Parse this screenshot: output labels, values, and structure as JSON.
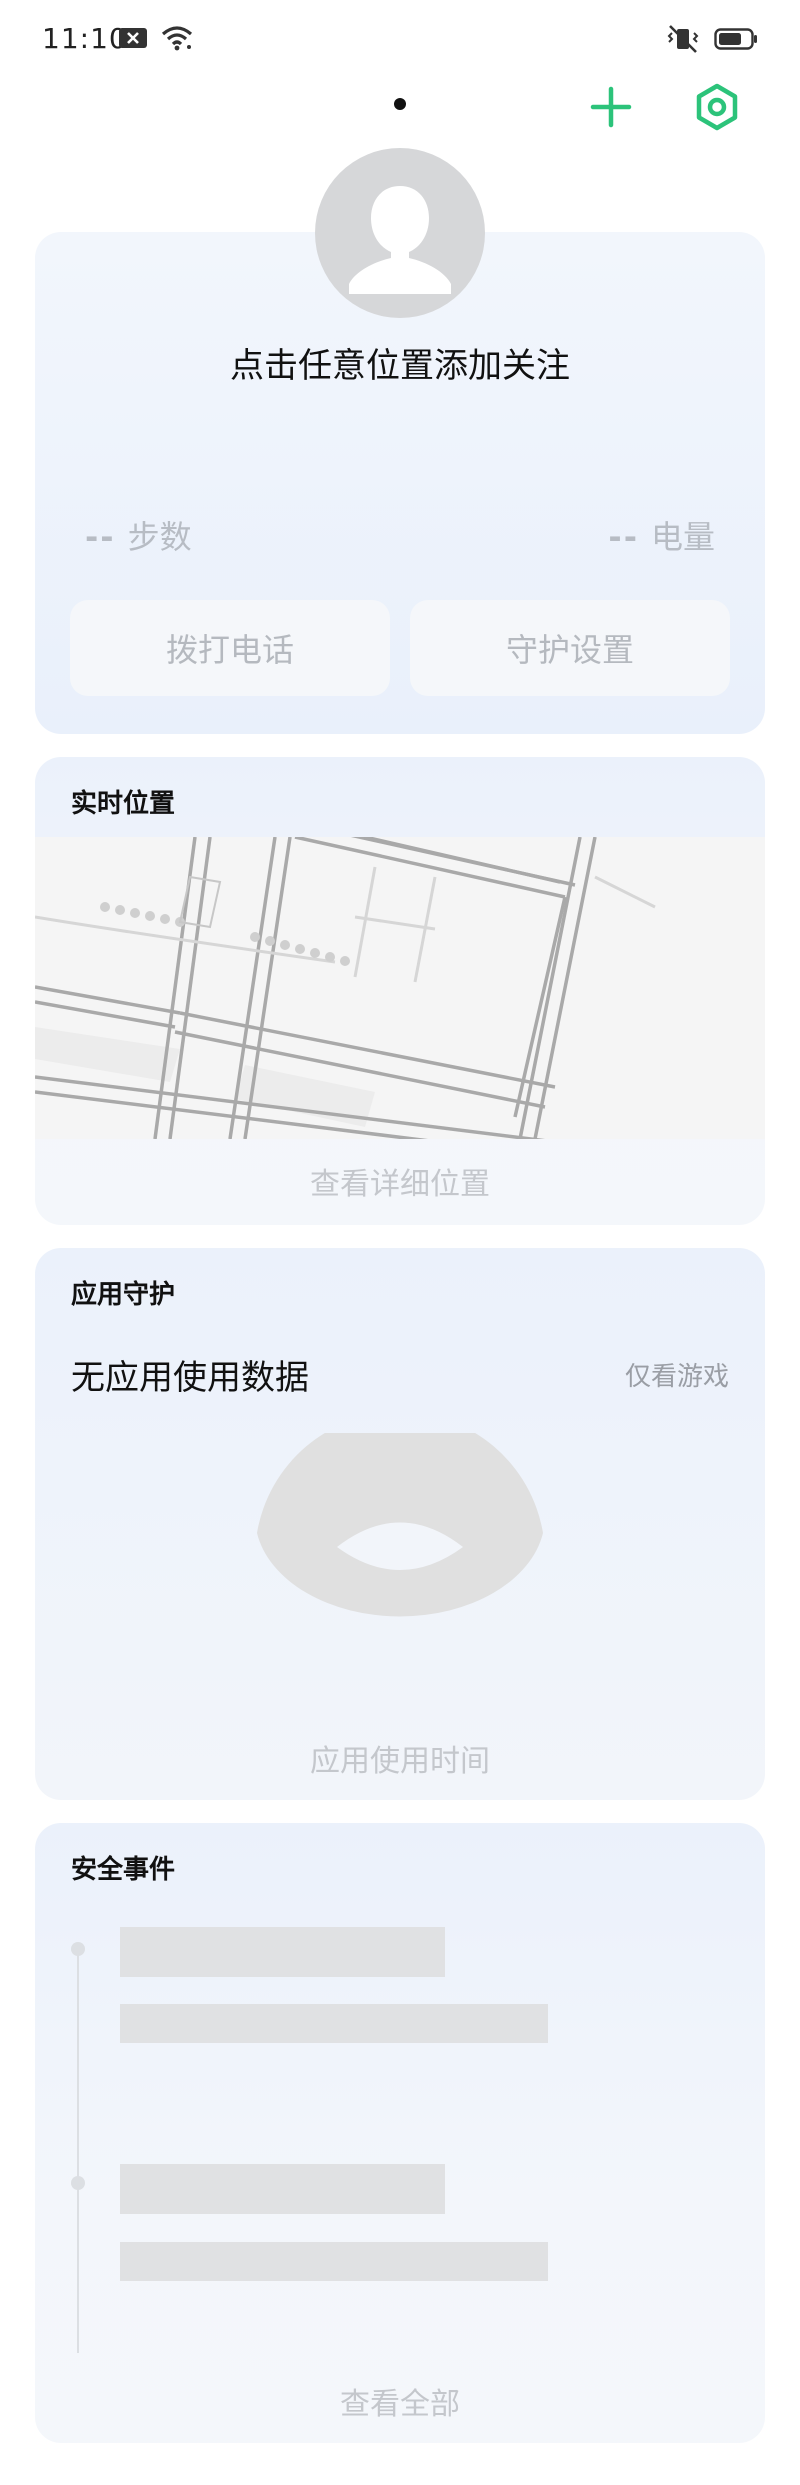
{
  "status_bar": {
    "time": "11:10",
    "icons_left": [
      "notification-x-icon",
      "wifi-icon"
    ],
    "icons_right": [
      "vibrate-mute-icon",
      "battery-icon"
    ]
  },
  "topbar": {
    "page_indicator": "dot",
    "icons": [
      "plus-icon",
      "settings-icon"
    ],
    "accent_color": "#2cc37a"
  },
  "profile": {
    "avatar_icon": "person-icon",
    "prompt": "点击任意位置添加关注",
    "steps_value": "--",
    "steps_label": "步数",
    "battery_value": "--",
    "battery_label": "电量",
    "call_label": "拨打电话",
    "guard_settings_label": "守护设置"
  },
  "location": {
    "title": "实时位置",
    "view_detail": "查看详细位置"
  },
  "app_guard": {
    "title": "应用守护",
    "no_data": "无应用使用数据",
    "games_only": "仅看游戏",
    "usage_time": "应用使用时间"
  },
  "security": {
    "title": "安全事件",
    "view_all": "查看全部"
  }
}
